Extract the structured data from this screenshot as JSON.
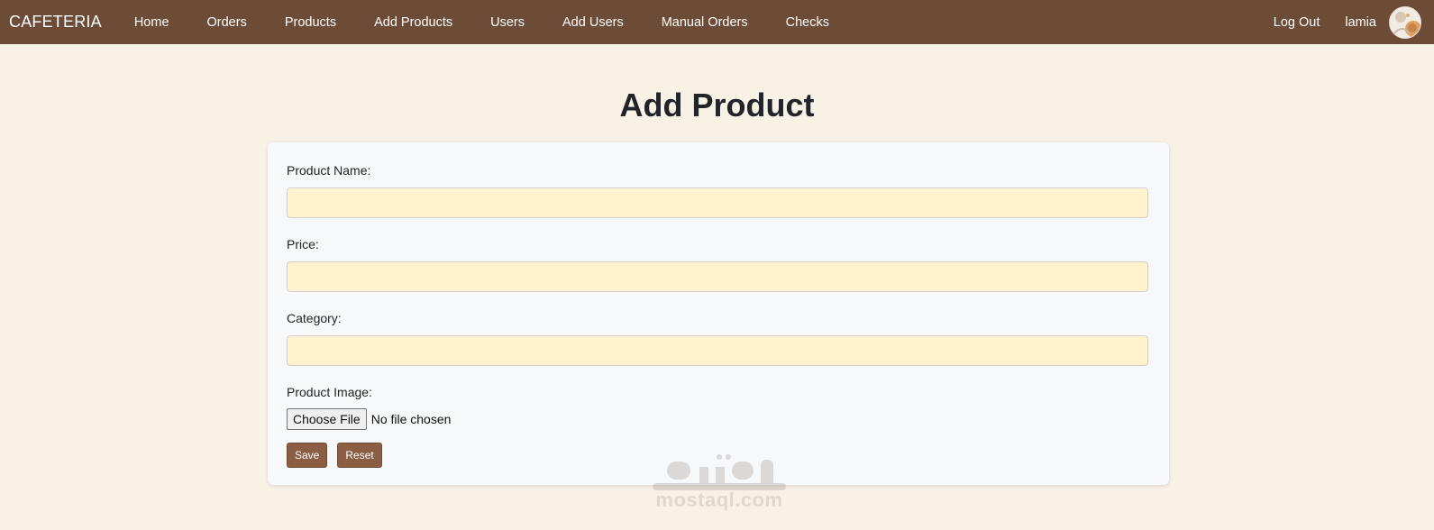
{
  "navbar": {
    "brand": "CAFETERIA",
    "links": [
      {
        "label": "Home"
      },
      {
        "label": "Orders"
      },
      {
        "label": "Products"
      },
      {
        "label": "Add Products"
      },
      {
        "label": "Users"
      },
      {
        "label": "Add Users"
      },
      {
        "label": "Manual Orders"
      },
      {
        "label": "Checks"
      }
    ],
    "logout_label": "Log Out",
    "username": "lamia",
    "background_color": "#6d4c37"
  },
  "page": {
    "title": "Add Product"
  },
  "form": {
    "product_name": {
      "label": "Product Name:",
      "value": ""
    },
    "price": {
      "label": "Price:",
      "value": ""
    },
    "category": {
      "label": "Category:",
      "value": ""
    },
    "product_image": {
      "label": "Product Image:",
      "button_label": "Choose File",
      "status": "No file chosen"
    },
    "save_label": "Save",
    "reset_label": "Reset",
    "input_background": "#fff2cc",
    "button_color": "#8b5e44"
  },
  "watermark": {
    "text": "mostaql.com",
    "logo_icon": "mostaql-logo-icon"
  }
}
